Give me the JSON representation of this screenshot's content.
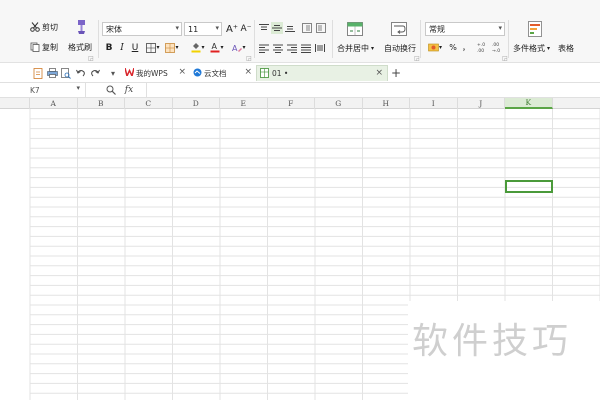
{
  "ribbon": {
    "cut": "剪切",
    "copy": "复制",
    "format_painter": "格式刷",
    "font_name": "宋体",
    "font_size": "11",
    "grow_font": "A⁺",
    "shrink_font": "A⁻",
    "bold": "B",
    "italic": "I",
    "underline": "U",
    "merge_center": "合并居中",
    "wrap_text": "自动换行",
    "number_format": "常规",
    "percent": "%",
    "thousands": "，",
    "inc_decimal": "+.0\n.00",
    "conditional_format": "多件格式",
    "table_style": "表格"
  },
  "tabs": [
    {
      "label": "我的WPS",
      "close": "×"
    },
    {
      "label": "云文档",
      "close": "×"
    },
    {
      "label": "01 •",
      "close": "×"
    }
  ],
  "new_tab": "+",
  "formula_bar": {
    "name_box": "K7",
    "fx": "fx"
  },
  "columns": [
    "A",
    "B",
    "C",
    "D",
    "E",
    "F",
    "G",
    "H",
    "I",
    "J",
    "K"
  ],
  "selected_column": "K",
  "watermark": "软件技巧",
  "colors": {
    "accent": "#5aa545",
    "wps_red": "#d9262c",
    "cloud_blue": "#1e78d7"
  }
}
